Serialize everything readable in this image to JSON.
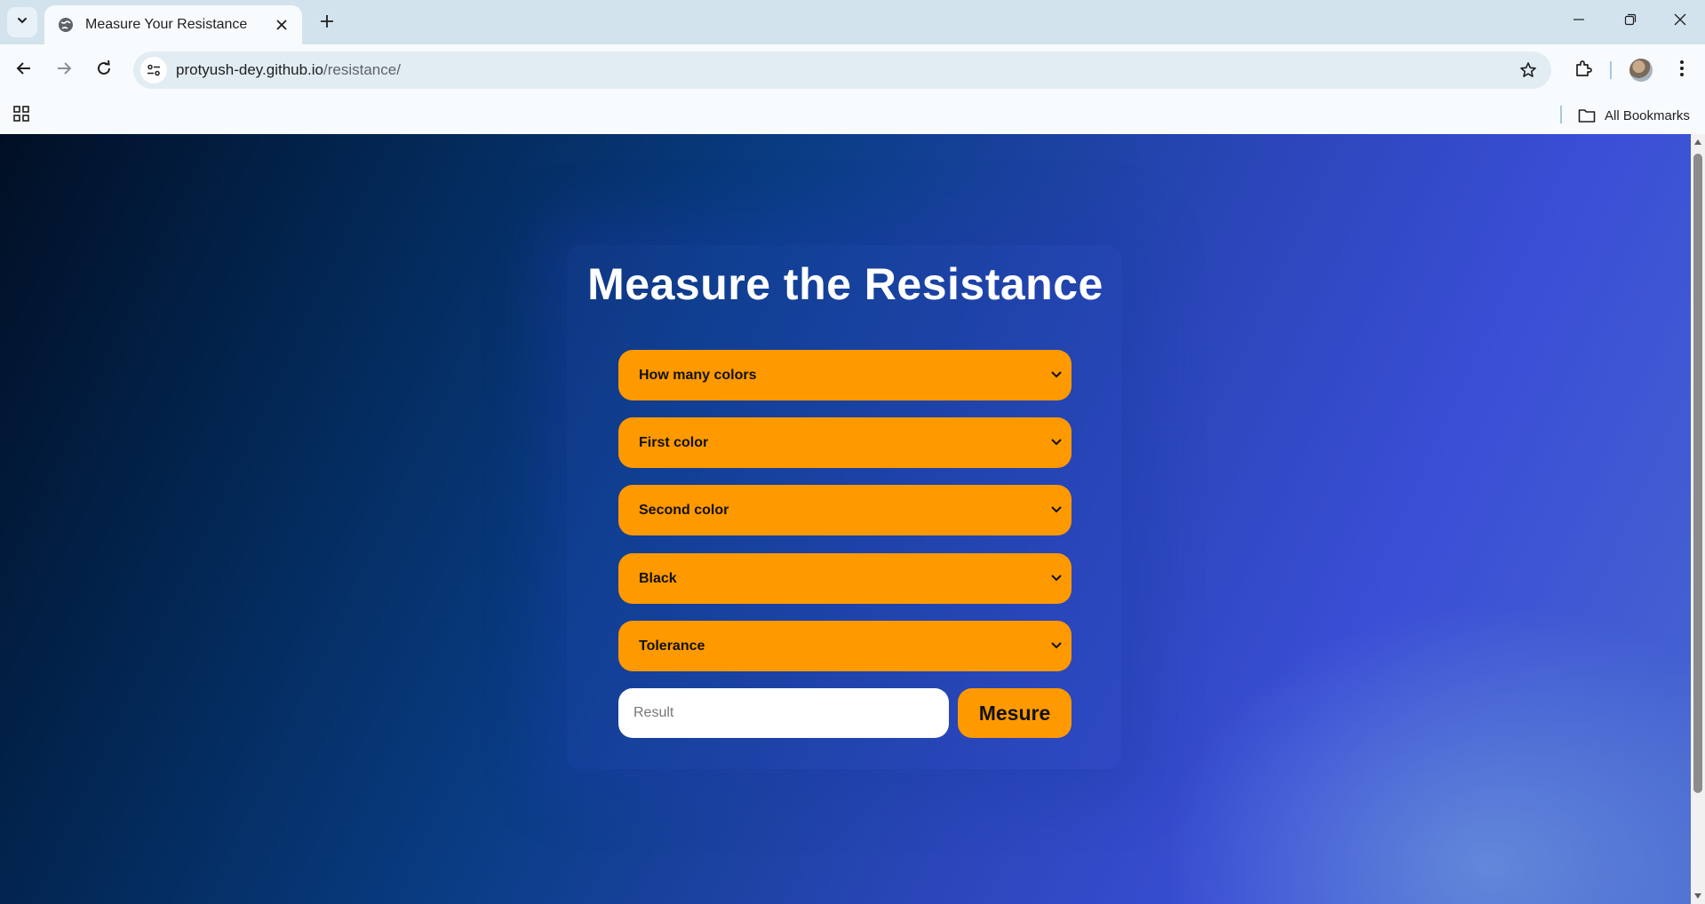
{
  "browser": {
    "tab": {
      "title": "Measure Your Resistance"
    },
    "address": {
      "url_host": "protyush-dey.github.io",
      "url_path": "/resistance/"
    },
    "bookmarks": {
      "all_label": "All Bookmarks"
    },
    "icons": [
      "tab-search-icon",
      "globe-icon",
      "close-icon",
      "plus-icon",
      "minimize-icon",
      "restore-icon",
      "window-close-icon",
      "back-arrow-icon",
      "forward-arrow-icon",
      "reload-icon",
      "site-info-icon",
      "star-icon",
      "extensions-icon",
      "profile-avatar",
      "more-vert-icon",
      "apps-grid-icon",
      "folder-icon"
    ]
  },
  "page": {
    "title": "Measure the Resistance",
    "selects": {
      "count": "How many colors",
      "first": "First color",
      "second": "Second color",
      "multiplier": "Black",
      "tolerance": "Tolerance"
    },
    "result_placeholder": "Result",
    "measure_label": "Mesure"
  },
  "colors": {
    "accent": "#fe9900",
    "chrome_tabbar": "#d3e3ed",
    "gradient_dark": "#010f24",
    "gradient_mid": "#0a3d86",
    "gradient_light": "#3a4ed6"
  }
}
